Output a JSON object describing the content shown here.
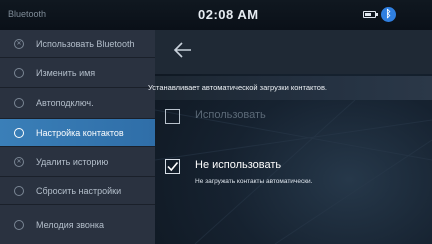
{
  "status_bar": {
    "source": "Bluetooth",
    "signal": "",
    "time": "02:08 AM",
    "battery_level": 0.7,
    "bluetooth_icon": "bluetooth-icon"
  },
  "sidebar": {
    "items": [
      {
        "label": "Использовать Bluetooth",
        "icon": "bluetooth-toggle-icon",
        "active": false
      },
      {
        "label": "Изменить имя",
        "icon": "edit-icon",
        "active": false
      },
      {
        "label": "Автоподключ.",
        "icon": "auto-connect-icon",
        "active": false
      },
      {
        "label": "Настройка контактов",
        "icon": "contacts-icon",
        "active": true
      },
      {
        "label": "Удалить историю",
        "icon": "delete-history-icon",
        "active": false
      },
      {
        "label": "Сбросить настройки",
        "icon": "reset-icon",
        "active": false
      },
      {
        "label": "Мелодия звонка",
        "icon": "ringtone-icon",
        "active": false
      }
    ]
  },
  "main": {
    "back_icon": "back-arrow-icon",
    "description": "Устанавливает автоматической загрузки контактов.",
    "options": [
      {
        "title": "Использовать",
        "subtitle": "",
        "checked": false,
        "disabled": true
      },
      {
        "title": "Не использовать",
        "subtitle": "Не загружать контакты автоматически.",
        "checked": true,
        "disabled": false
      }
    ]
  },
  "colors": {
    "accent": "#3a7fb8",
    "sidebar_bg": "#2a3240",
    "bluetooth": "#2f7fe0"
  }
}
